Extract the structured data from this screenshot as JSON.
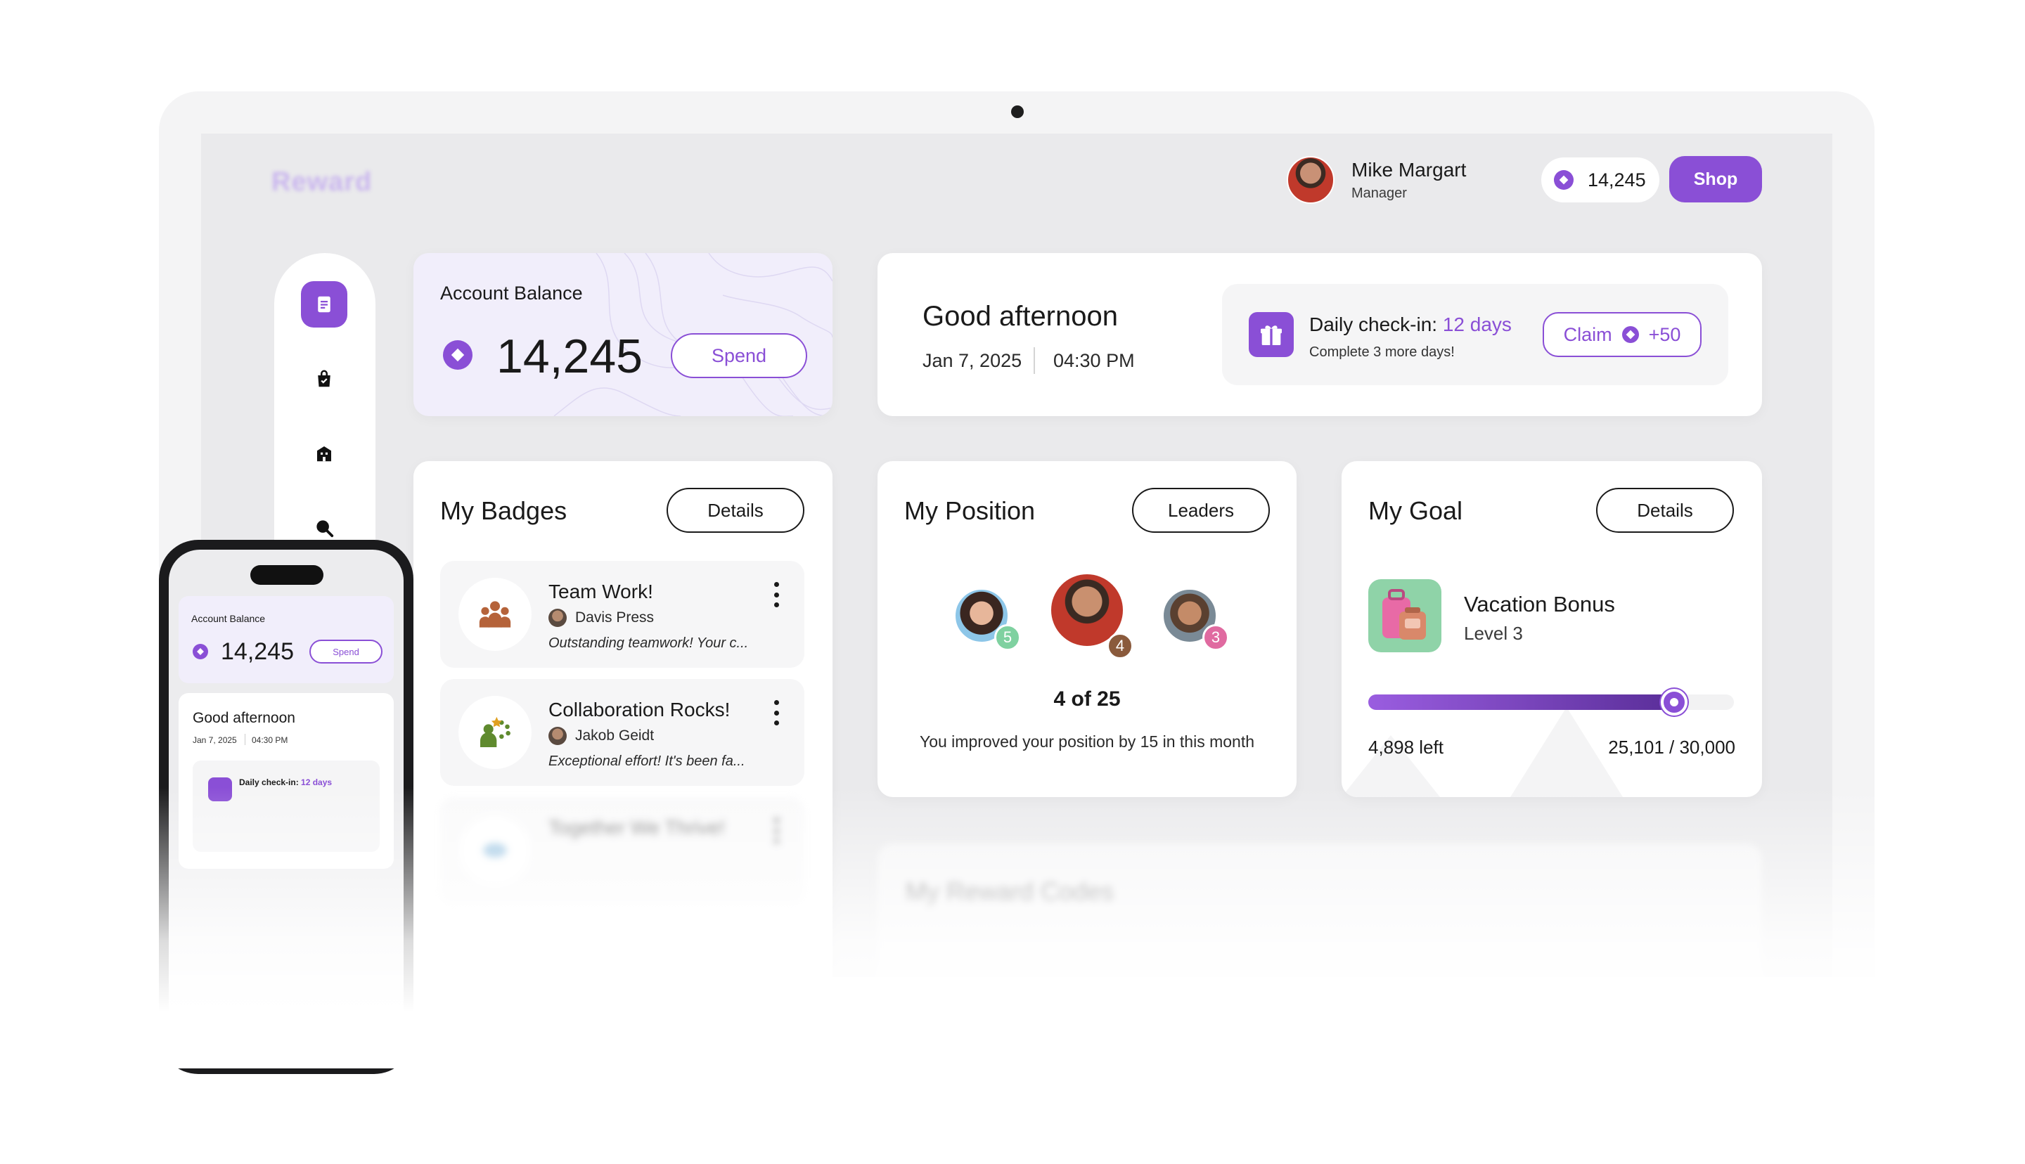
{
  "app": {
    "logo": "Reward"
  },
  "user": {
    "name": "Mike Margart",
    "role": "Manager"
  },
  "header": {
    "balance": "14,245",
    "shop_label": "Shop"
  },
  "sidebar": {
    "items": [
      {
        "icon": "document-icon",
        "active": true
      },
      {
        "icon": "shopping-bag-icon",
        "active": false
      },
      {
        "icon": "building-icon",
        "active": false
      },
      {
        "icon": "search-icon",
        "active": false
      }
    ]
  },
  "balance_card": {
    "label": "Account Balance",
    "value": "14,245",
    "spend_label": "Spend"
  },
  "greeting": {
    "title": "Good afternoon",
    "date": "Jan 7, 2025",
    "time": "04:30 PM",
    "checkin_label": "Daily check-in:",
    "checkin_days": "12 days",
    "checkin_sub": "Complete 3 more days!",
    "claim_label": "Claim",
    "claim_reward": "+50"
  },
  "badges": {
    "title": "My Badges",
    "details_label": "Details",
    "items": [
      {
        "name": "Team Work!",
        "author": "Davis Press",
        "desc": "Outstanding teamwork! Your c..."
      },
      {
        "name": "Collaboration Rocks!",
        "author": "Jakob Geidt",
        "desc": "Exceptional effort! It's been fa..."
      },
      {
        "name": "Together We Thrive!",
        "author": "",
        "desc": ""
      }
    ]
  },
  "position": {
    "title": "My Position",
    "leaders_label": "Leaders",
    "leaders": [
      {
        "rank": "5",
        "color": "#7fd1a0"
      },
      {
        "rank": "4",
        "color": "#8a5a3c"
      },
      {
        "rank": "3",
        "color": "#e06aa0"
      }
    ],
    "rank_text": "4 of 25",
    "note": "You improved your position by 15 in this month"
  },
  "goal": {
    "title": "My Goal",
    "details_label": "Details",
    "name": "Vacation Bonus",
    "level": "Level 3",
    "progress": 0.837,
    "left_text": "4,898 left",
    "total_text": "25,101 / 30,000"
  },
  "history": {
    "title": "My Reward Codes"
  },
  "phone": {
    "balance_label": "Account Balance",
    "balance_value": "14,245",
    "spend_label": "Spend",
    "greet_title": "Good afternoon",
    "date": "Jan 7, 2025",
    "time": "04:30 PM",
    "checkin_label": "Daily check-in:",
    "checkin_days": "12 days"
  },
  "colors": {
    "accent": "#8a4fd6",
    "screen_bg": "#eaeaec",
    "card_bg": "#ffffff"
  }
}
